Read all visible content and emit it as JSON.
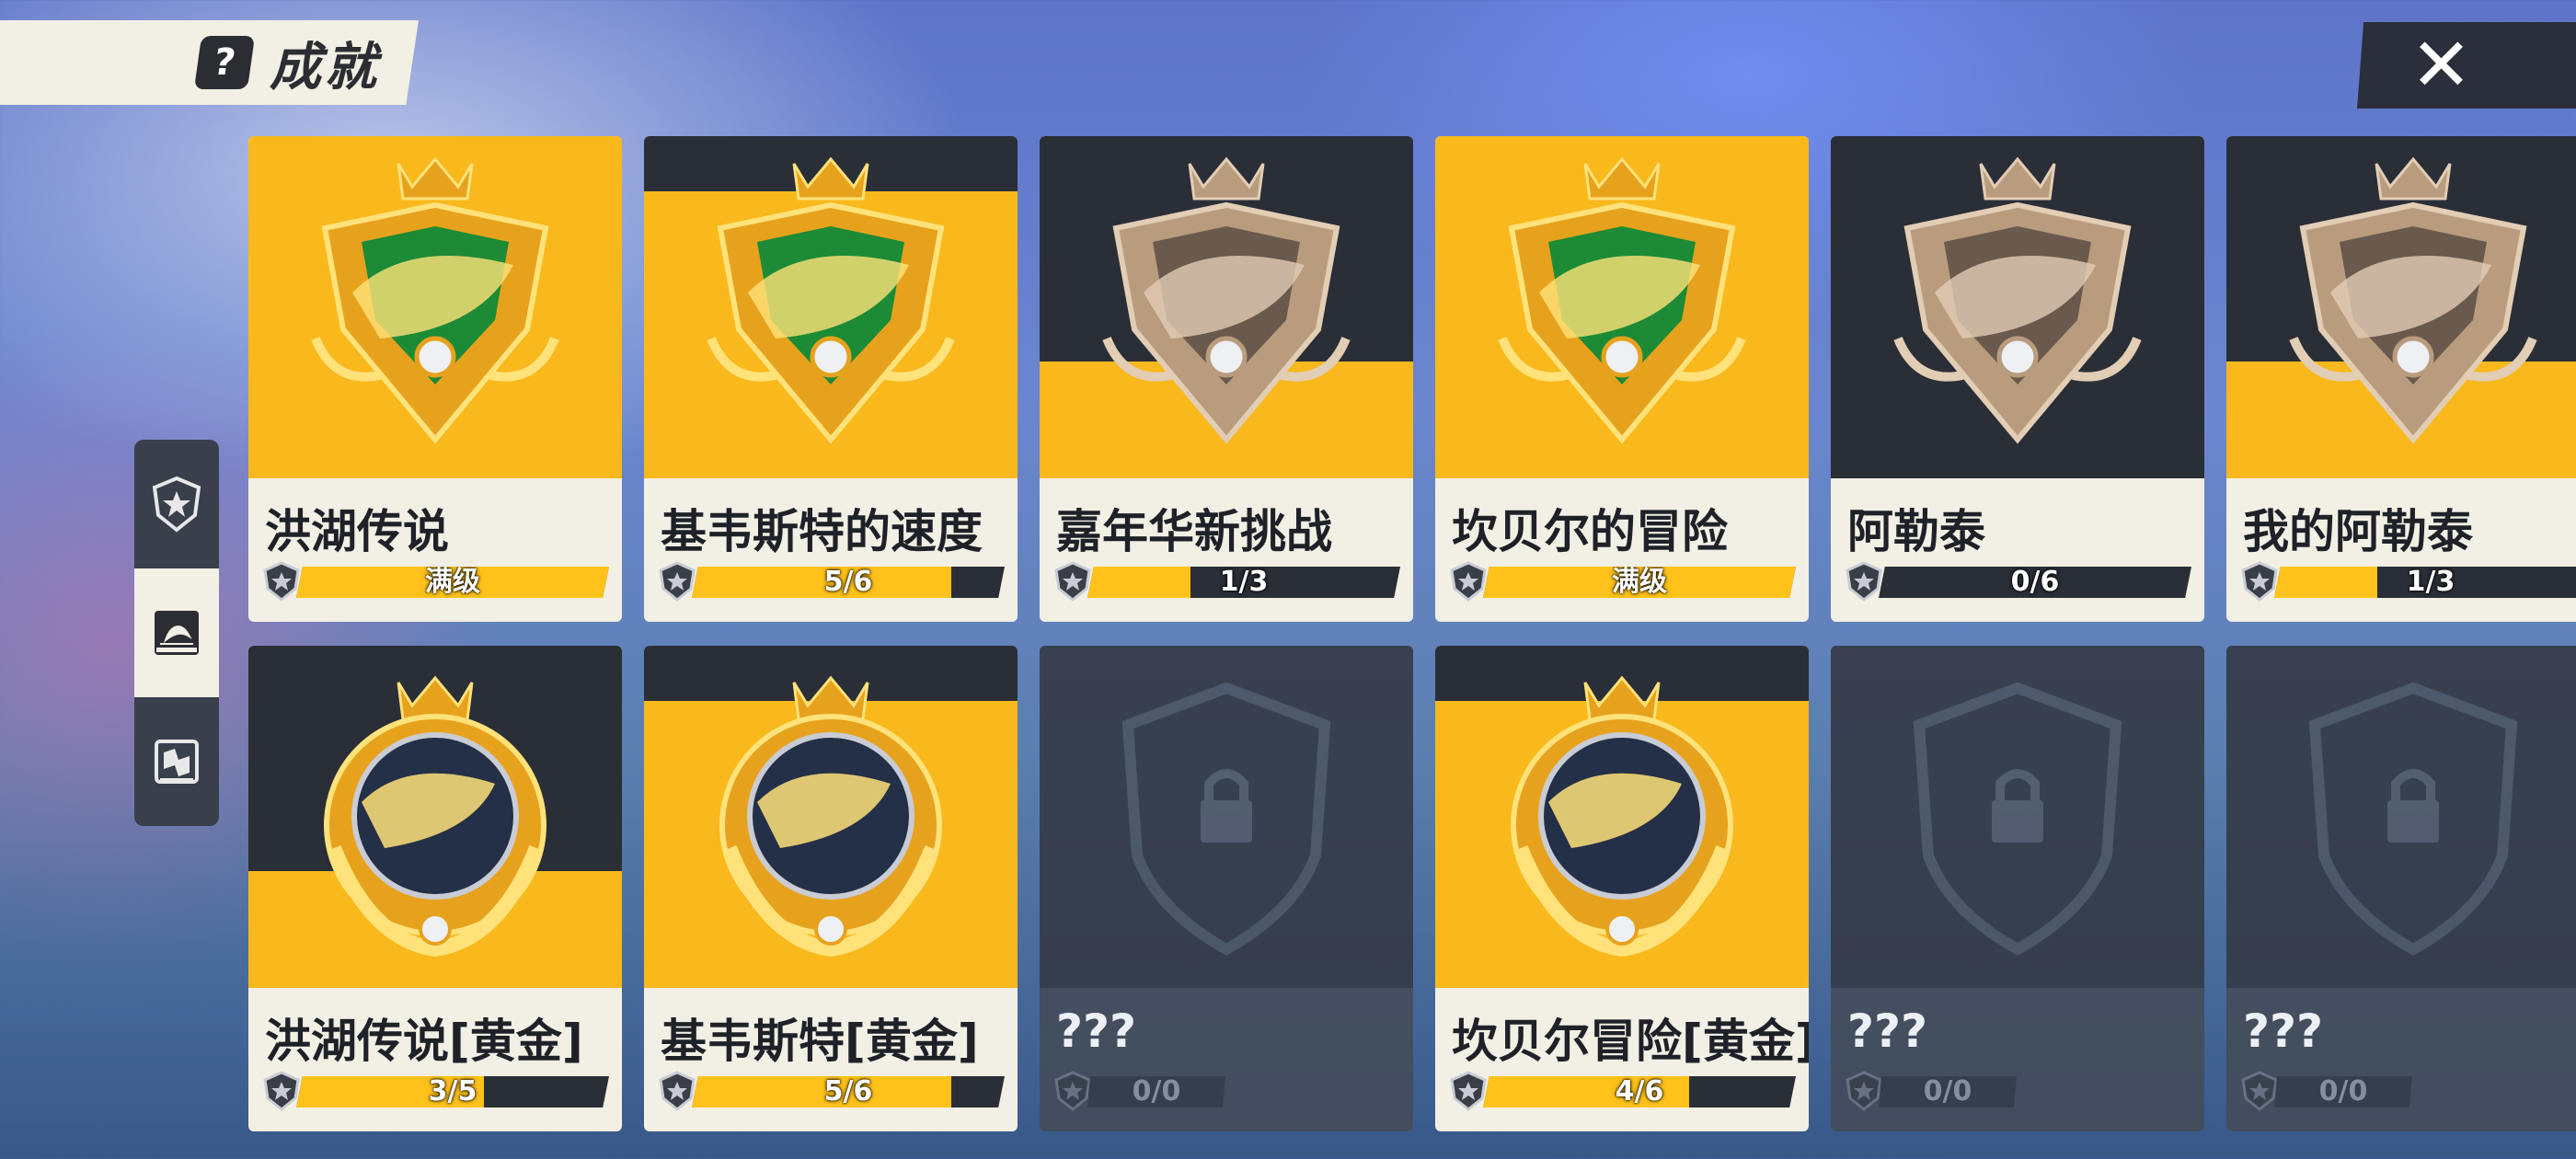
{
  "header": {
    "title": "成就",
    "help_icon": "question-icon"
  },
  "close_icon": "close-icon",
  "side_tabs": [
    {
      "icon": "star-shield-icon",
      "active": false
    },
    {
      "icon": "fish-book-icon",
      "active": true
    },
    {
      "icon": "map-book-icon",
      "active": false
    }
  ],
  "colors": {
    "accent": "#f9b81c",
    "dark": "#2a2e37",
    "card": "#f2efe4",
    "locked": "#444c5a"
  },
  "achievements": [
    {
      "name": "洪湖传说",
      "progress_text": "满级",
      "progress": 1.0,
      "style": "gold",
      "medal": "gold-shield"
    },
    {
      "name": "基韦斯特的速度",
      "progress_text": "5/6",
      "progress": 0.83,
      "style": "split",
      "medal": "gold-shield"
    },
    {
      "name": "嘉年华新挑战",
      "progress_text": "1/3",
      "progress": 0.33,
      "style": "split2",
      "medal": "bronze-shield"
    },
    {
      "name": "坎贝尔的冒险",
      "progress_text": "满级",
      "progress": 1.0,
      "style": "gold",
      "medal": "gold-shield"
    },
    {
      "name": "阿勒泰",
      "progress_text": "0/6",
      "progress": 0.0,
      "style": "dark",
      "medal": "bronze-shield"
    },
    {
      "name": "我的阿勒泰",
      "progress_text": "1/3",
      "progress": 0.33,
      "style": "split3",
      "medal": "bronze-shield"
    },
    {
      "name": "洪湖传说[黄金]",
      "progress_text": "3/5",
      "progress": 0.6,
      "style": "split2",
      "medal": "gold-wreath"
    },
    {
      "name": "基韦斯特[黄金]",
      "progress_text": "5/6",
      "progress": 0.83,
      "style": "split",
      "medal": "gold-wreath"
    },
    {
      "name": "???",
      "progress_text": "0/0",
      "progress": 0.0,
      "style": "locked",
      "medal": "lock"
    },
    {
      "name": "坎贝尔冒险[黄金]",
      "progress_text": "4/6",
      "progress": 0.66,
      "style": "split",
      "medal": "gold-wreath"
    },
    {
      "name": "???",
      "progress_text": "0/0",
      "progress": 0.0,
      "style": "locked",
      "medal": "lock"
    },
    {
      "name": "???",
      "progress_text": "0/0",
      "progress": 0.0,
      "style": "locked",
      "medal": "lock"
    }
  ]
}
